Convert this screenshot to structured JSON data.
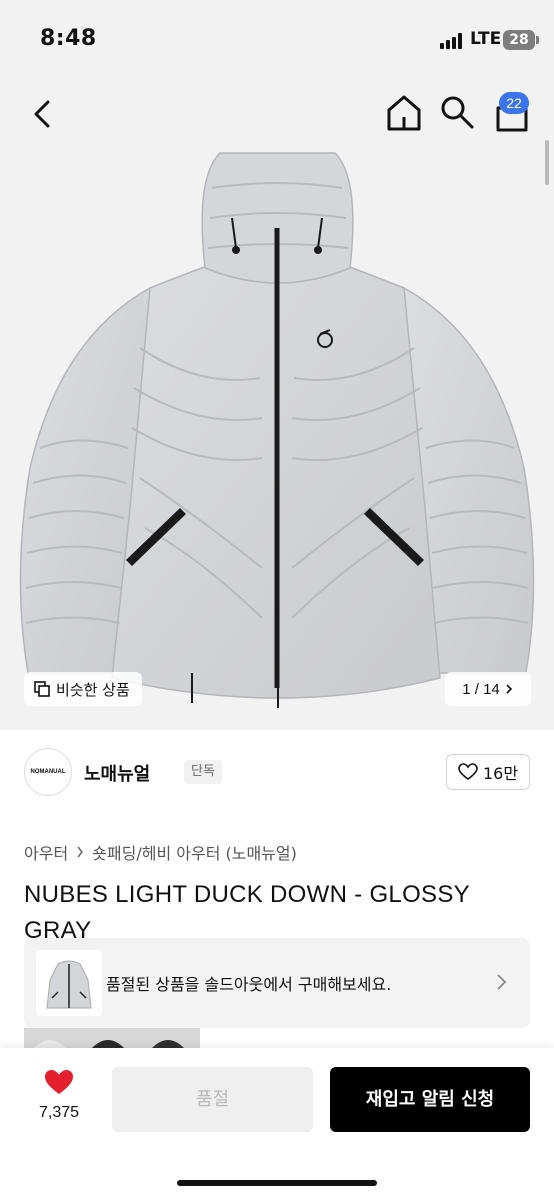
{
  "status": {
    "time": "8:48",
    "network": "LTE",
    "battery": "28"
  },
  "nav": {
    "back_icon": "chevron-left-icon",
    "home_icon": "home-icon",
    "search_icon": "search-icon",
    "cart_icon": "cart-icon",
    "cart_count": "22"
  },
  "gallery": {
    "similar_label": "비슷한 상품",
    "counter": "1 / 14"
  },
  "brand": {
    "logo_text": "NOMANUAL",
    "name": "노매뉴얼",
    "tag": "단독",
    "likes": "16만"
  },
  "breadcrumb": {
    "category": "아우터",
    "subcategory": "숏패딩/헤비 아우터 (노매뉴얼)"
  },
  "product": {
    "title": "NUBES LIGHT DUCK DOWN - GLOSSY GRAY"
  },
  "soldout_banner": {
    "text": "품절된 상품을 솔드아웃에서 구매해보세요."
  },
  "bottom": {
    "wish_count": "7,375",
    "soldout_label": "품절",
    "restock_label": "재입고 알림 신청"
  },
  "colors": {
    "accent": "#3b74ec",
    "wish": "#e5202e",
    "primary_button": "#000000"
  }
}
